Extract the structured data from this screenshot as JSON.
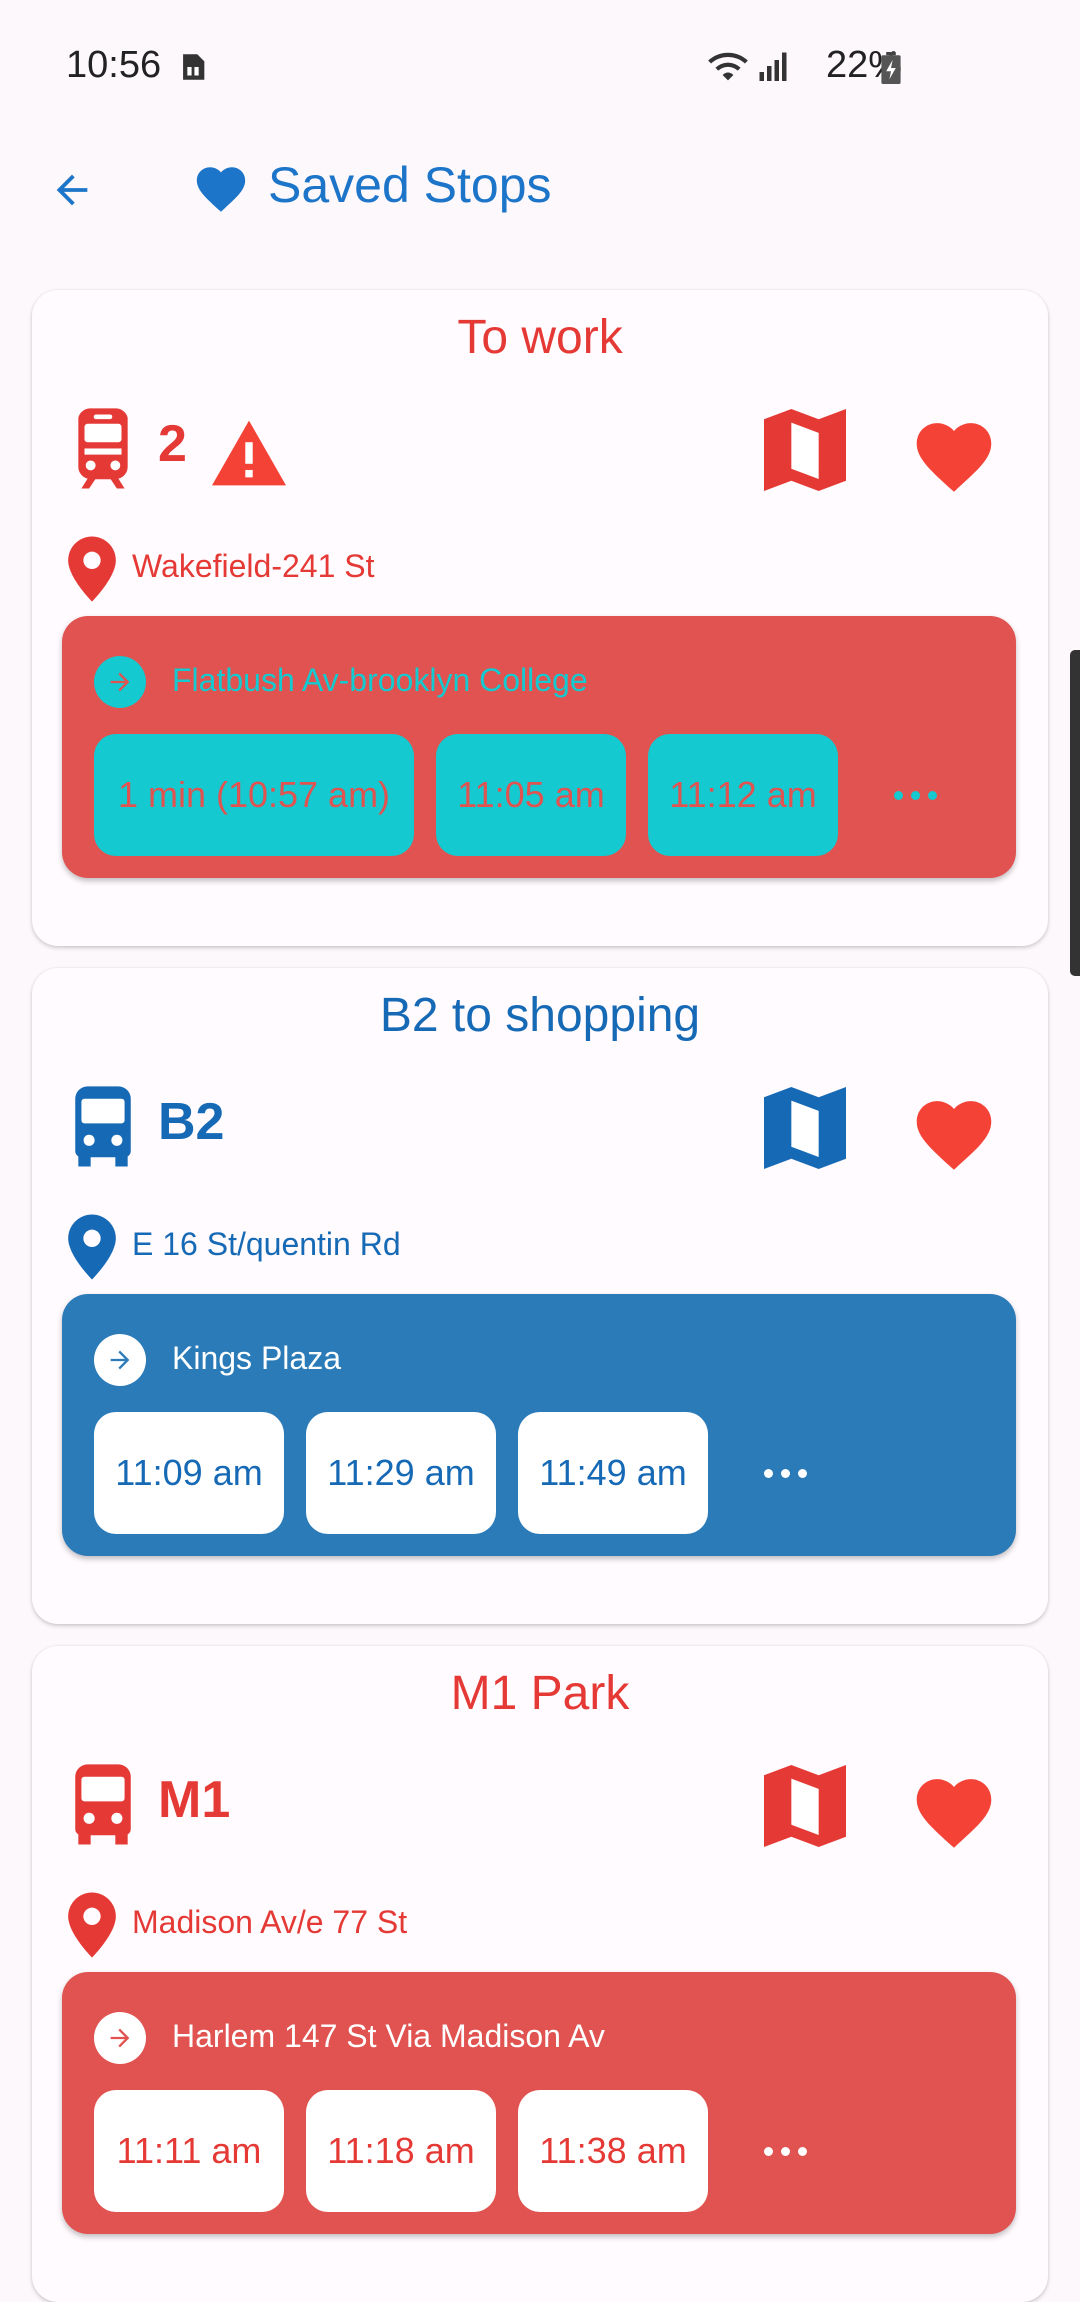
{
  "status_bar": {
    "time": "10:56",
    "battery": "22%"
  },
  "app_bar": {
    "title": "Saved Stops"
  },
  "cards": [
    {
      "title": "To work",
      "route": "2",
      "stop": "Wakefield-241 St",
      "direction": "Flatbush Av-brooklyn College",
      "times": [
        "1 min (10:57 am)",
        "11:05 am",
        "11:12 am"
      ]
    },
    {
      "title": "B2 to shopping",
      "route": "B2",
      "stop": "E 16 St/quentin Rd",
      "direction": "Kings Plaza",
      "times": [
        "11:09 am",
        "11:29 am",
        "11:49 am"
      ]
    },
    {
      "title": "M1 Park",
      "route": "M1",
      "stop": "Madison Av/e 77 St",
      "direction": "Harlem 147 St Via Madison Av",
      "times": [
        "11:11 am",
        "11:18 am",
        "11:38 am"
      ]
    }
  ],
  "colors": {
    "red": "#e53935",
    "red_box": "#e05350",
    "blue": "#1669b5",
    "blue_box": "#2b7bb9",
    "cyan_chip": "#14c9cf",
    "heart": "#f44336",
    "title_blue": "#1c75c8"
  },
  "icons": [
    "back-arrow-icon",
    "heart-icon",
    "train-icon",
    "bus-icon",
    "alert-icon",
    "map-icon",
    "location-pin-icon",
    "arrow-right-circle-icon",
    "more-icon"
  ]
}
